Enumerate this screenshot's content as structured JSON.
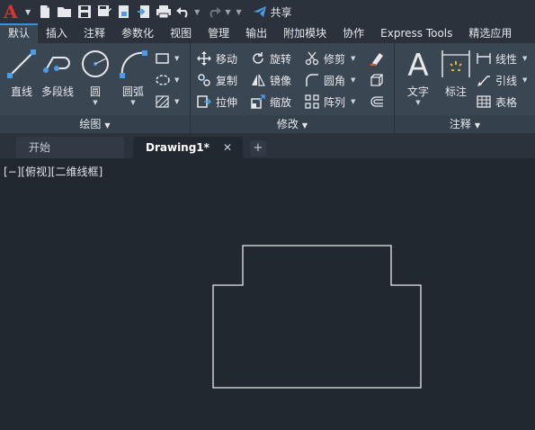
{
  "qat": {
    "share_label": "共享"
  },
  "tabs": [
    "默认",
    "插入",
    "注释",
    "参数化",
    "视图",
    "管理",
    "输出",
    "附加模块",
    "协作",
    "Express Tools",
    "精选应用"
  ],
  "draw_panel": {
    "title": "绘图",
    "tools": {
      "line": "直线",
      "polyline": "多段线",
      "circle": "圆",
      "arc": "圆弧"
    }
  },
  "modify_panel": {
    "title": "修改",
    "tools": {
      "move": "移动",
      "rotate": "旋转",
      "trim": "修剪",
      "copy": "复制",
      "mirror": "镜像",
      "fillet": "圆角",
      "stretch": "拉伸",
      "scale": "缩放",
      "array": "阵列"
    }
  },
  "annotation_panel": {
    "title": "注释",
    "tools": {
      "text": "文字",
      "dimension": "标注",
      "linear": "线性",
      "leader": "引线",
      "table": "表格"
    }
  },
  "doc_tabs": {
    "start": "开始",
    "drawing": "Drawing1*"
  },
  "viewport_label": "[−][俯视][二维线框]",
  "colors": {
    "accent": "#3d8fe0",
    "app_red": "#e0322c",
    "canvas": "#212830",
    "ribbon": "#3b4653"
  }
}
